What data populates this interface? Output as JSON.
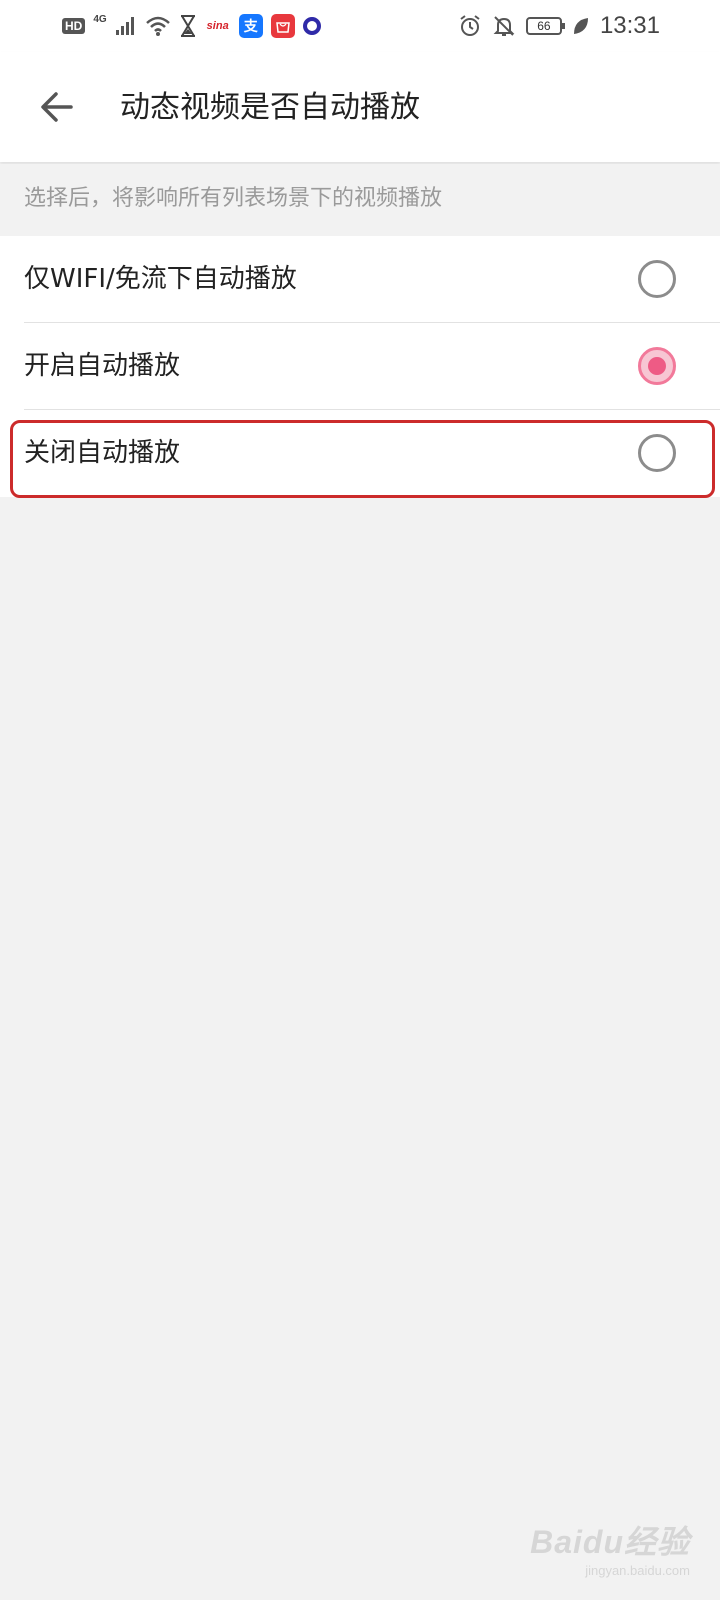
{
  "status_bar": {
    "hd_label": "HD",
    "network_label": "4G",
    "sina_label": "sina",
    "alipay_label": "支",
    "battery_level": "66",
    "time": "13:31",
    "icons": [
      "signal-icon",
      "wifi-icon",
      "hourglass-icon",
      "sina-app-icon",
      "alipay-app-icon",
      "mall-app-icon",
      "circle-app-icon",
      "alarm-icon",
      "bell-off-icon",
      "battery-icon",
      "leaf-icon"
    ]
  },
  "header": {
    "back_icon": "arrow-left-icon",
    "title": "动态视频是否自动播放"
  },
  "hint": {
    "text": "选择后，将影响所有列表场景下的视频播放"
  },
  "options": [
    {
      "label": "仅WIFI/免流下自动播放",
      "selected": false
    },
    {
      "label": "开启自动播放",
      "selected": true
    },
    {
      "label": "关闭自动播放",
      "selected": false
    }
  ],
  "watermark": {
    "logo": "Baidu经验",
    "url": "jingyan.baidu.com"
  },
  "colors": {
    "accent": "#ee5b85",
    "highlight": "#cc2b2b",
    "background": "#f2f2f2"
  }
}
